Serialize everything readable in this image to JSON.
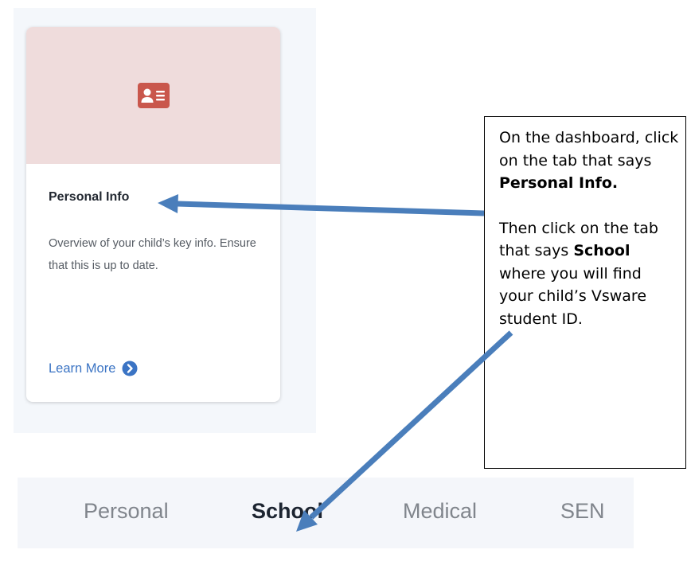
{
  "card": {
    "icon": "id-card-icon",
    "title": "Personal Info",
    "description": "Overview of your child’s key info. Ensure that this is up to date.",
    "link_label": "Learn More",
    "link_icon": "chevron-right-circle-icon",
    "hero_color": "#efdcdc",
    "icon_color": "#c9574c",
    "link_color": "#3b74c4"
  },
  "callout": {
    "line1_prefix": "On the dashboard, click on the tab that says ",
    "line1_bold": "Personal Info.",
    "line2_prefix": "Then click on the tab that says ",
    "line2_bold": "School",
    "line2_suffix": " where you will find your child’s Vsware student ID."
  },
  "tabs": [
    {
      "label": "Personal",
      "active": false
    },
    {
      "label": "School",
      "active": true
    },
    {
      "label": "Medical",
      "active": false
    },
    {
      "label": "SEN",
      "active": false
    }
  ],
  "arrow_color": "#4a7ebb"
}
